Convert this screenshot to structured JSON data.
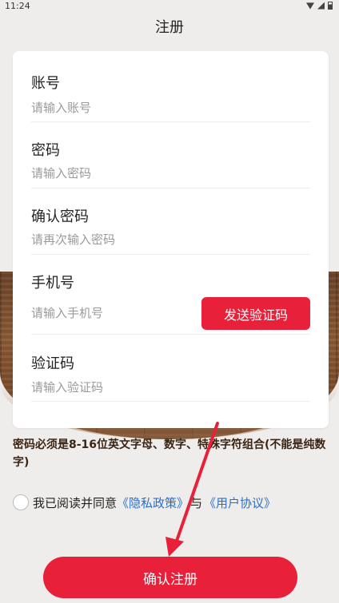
{
  "status_bar": {
    "time": "11:24"
  },
  "header": {
    "title": "注册"
  },
  "form": {
    "account": {
      "label": "账号",
      "placeholder": "请输入账号"
    },
    "password": {
      "label": "密码",
      "placeholder": "请输入密码"
    },
    "confirm_password": {
      "label": "确认密码",
      "placeholder": "请再次输入密码"
    },
    "phone": {
      "label": "手机号",
      "placeholder": "请输入手机号",
      "send_code_label": "发送验证码"
    },
    "code": {
      "label": "验证码",
      "placeholder": "请输入验证码"
    }
  },
  "hint": "密码必须是8-16位英文字母、数字、特殊字符组合(不能是纯数字)",
  "agreement": {
    "prefix": "我已阅读并同意",
    "privacy_link": "《隐私政策》",
    "and": "与",
    "user_link": "《用户协议》"
  },
  "submit_label": "确认注册",
  "colors": {
    "accent": "#e8203a",
    "link": "#2a6fc9",
    "annotation_arrow": "#e8203a"
  }
}
